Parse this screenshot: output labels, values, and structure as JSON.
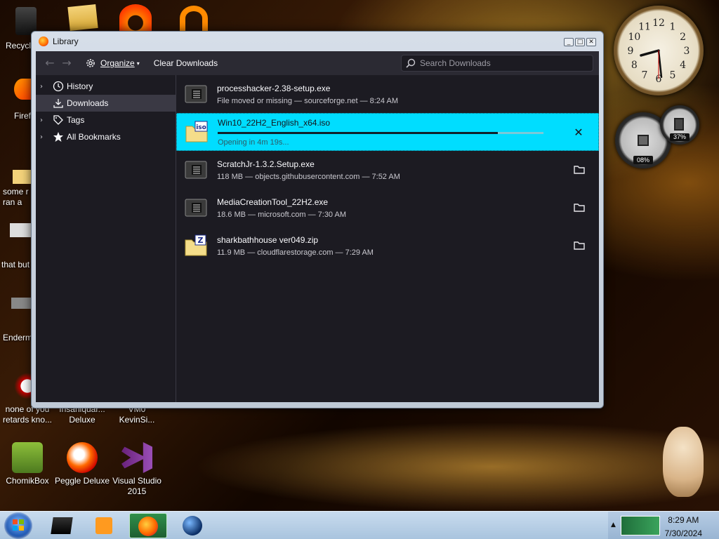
{
  "desktop": {
    "icons": [
      {
        "label": "Recycl",
        "name": "recycle-bin-icon"
      },
      {
        "label": "Firef",
        "name": "firefox-desktop-icon"
      },
      {
        "label": "some r\nran a",
        "name": "desktop-file-icon"
      },
      {
        "label": "that but",
        "name": "desktop-file-icon"
      },
      {
        "label": "Enderm",
        "name": "desktop-file-icon"
      },
      {
        "label": "none of you\nretards kno...",
        "name": "desktop-file-icon"
      },
      {
        "label": "Insaniquar...\nDeluxe",
        "name": "insaniquarium-icon"
      },
      {
        "label": "VM0\nKevinSi...",
        "name": "vm-icon"
      },
      {
        "label": "ChomikBox",
        "name": "chomikbox-icon"
      },
      {
        "label": "Peggle Deluxe",
        "name": "peggle-icon"
      },
      {
        "label": "Visual Studio\n2015",
        "name": "visual-studio-icon"
      }
    ]
  },
  "gadgets": {
    "clock": {
      "hour": 8,
      "minute": 29,
      "second": 30,
      "numerals": [
        "12",
        "1",
        "2",
        "3",
        "4",
        "5",
        "6",
        "7",
        "8",
        "9",
        "10",
        "11"
      ]
    },
    "cpu_meter": {
      "cpu": "08%",
      "memory": "37%"
    }
  },
  "window": {
    "title": "Library",
    "controls": {
      "minimize": "_",
      "maximize": "□",
      "close": "✕"
    },
    "toolbar": {
      "back_icon": "←",
      "forward_icon": "→",
      "organize_label": "Organize",
      "clear_label": "Clear Downloads",
      "search_placeholder": "Search Downloads"
    },
    "sidebar": {
      "items": [
        {
          "label": "History",
          "twisty": "›"
        },
        {
          "label": "Downloads",
          "twisty": ""
        },
        {
          "label": "Tags",
          "twisty": "›"
        },
        {
          "label": "All Bookmarks",
          "twisty": "›"
        }
      ]
    },
    "downloads": [
      {
        "name": "processhacker-2.38-setup.exe",
        "status": "File moved or missing — sourceforge.net — 8:24 AM",
        "icon": "exe-file-icon",
        "action": ""
      },
      {
        "name": "Win10_22H2_English_x64.iso",
        "status": "Opening in 4m 19s...",
        "icon": "iso-file-icon",
        "action": "✕",
        "progress": 0.86
      },
      {
        "name": "ScratchJr-1.3.2.Setup.exe",
        "status": "118 MB — objects.githubusercontent.com — 7:52 AM",
        "icon": "exe-file-icon",
        "action": "folder"
      },
      {
        "name": "MediaCreationTool_22H2.exe",
        "status": "18.6 MB — microsoft.com — 7:30 AM",
        "icon": "exe-file-icon",
        "action": "folder"
      },
      {
        "name": "sharkbathhouse ver049.zip",
        "status": "11.9 MB — cloudflarestorage.com — 7:29 AM",
        "icon": "zip-file-icon",
        "action": "folder"
      }
    ]
  },
  "taskbar": {
    "time": "8:29 AM",
    "date": "7/30/2024",
    "colors": {
      "active_app": "#2f8f4a",
      "download_highlight": "#00ddff"
    }
  }
}
